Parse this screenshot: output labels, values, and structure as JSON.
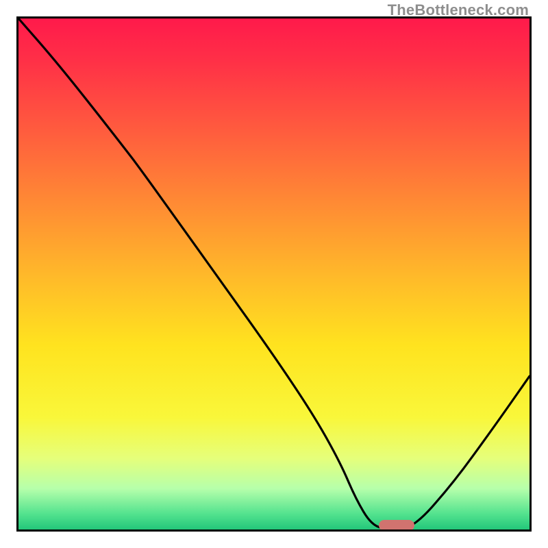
{
  "watermark": "TheBottleneck.com",
  "chart_data": {
    "type": "line",
    "title": "",
    "xlabel": "",
    "ylabel": "",
    "x_range": [
      0,
      100
    ],
    "y_range": [
      0,
      100
    ],
    "series": [
      {
        "name": "curve",
        "x": [
          0,
          7,
          15,
          22,
          23.5,
          30,
          40,
          50,
          58,
          63,
          66,
          69,
          72,
          77,
          85,
          93,
          100
        ],
        "y": [
          100,
          92,
          82,
          73,
          71,
          62,
          48,
          34,
          22,
          13,
          6,
          1,
          0,
          0,
          9,
          20,
          30
        ]
      }
    ],
    "marker": {
      "x": 74,
      "y": 0.8
    },
    "colors": {
      "curve": "#000000",
      "gradient_top": "#ff1a4b",
      "gradient_bottom": "#23c77a",
      "marker": "#d1736f",
      "frame": "#000000"
    }
  }
}
